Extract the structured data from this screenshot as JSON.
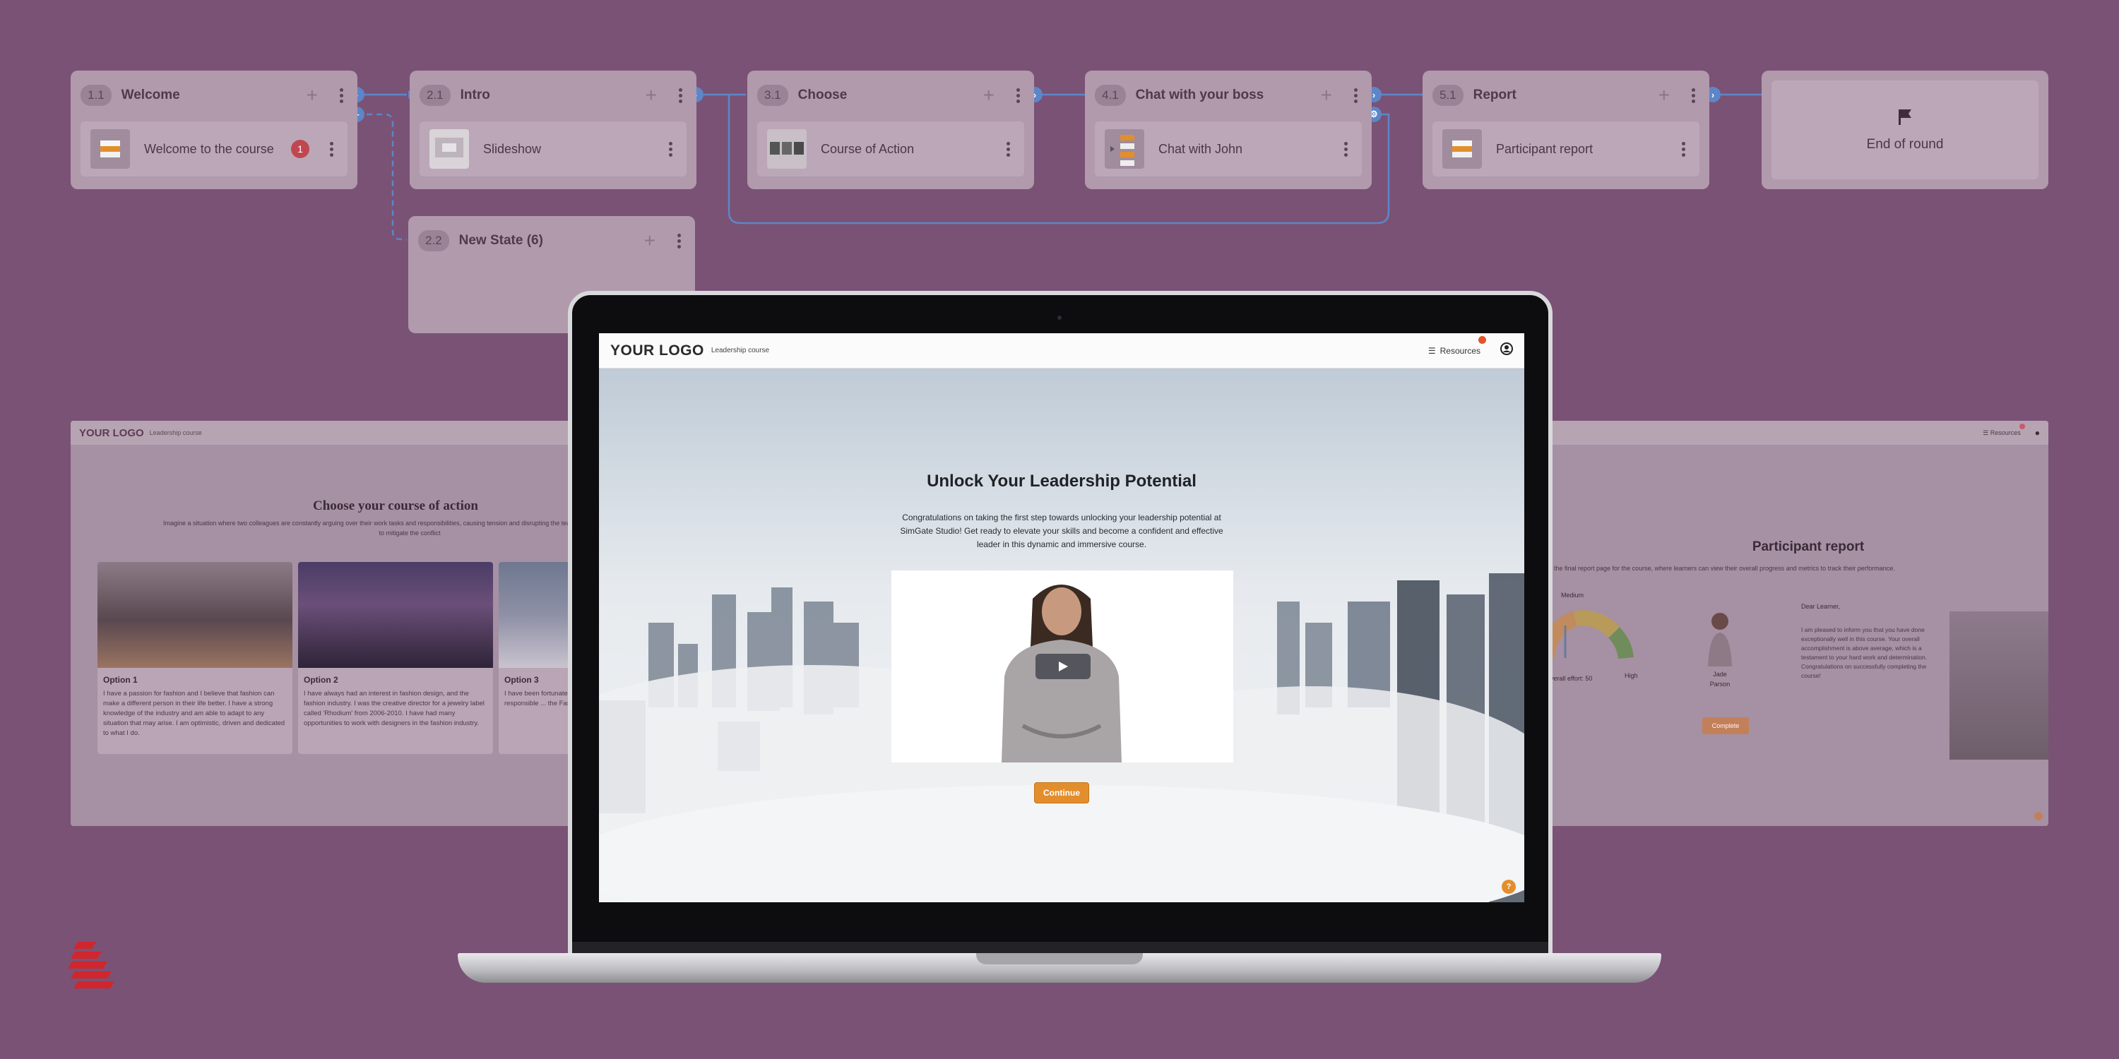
{
  "flow": {
    "states": [
      {
        "num": "1.1",
        "title": "Welcome",
        "item": "Welcome to the course",
        "badge": "1"
      },
      {
        "num": "2.1",
        "title": "Intro",
        "item": "Slideshow"
      },
      {
        "num": "3.1",
        "title": "Choose",
        "item": "Course of Action"
      },
      {
        "num": "4.1",
        "title": "Chat with your boss",
        "item": "Chat with John"
      },
      {
        "num": "5.1",
        "title": "Report",
        "item": "Participant report"
      }
    ],
    "new_state": {
      "num": "2.2",
      "title": "New State (6)"
    },
    "end": {
      "label": "End of round",
      "icon": "flag-icon"
    }
  },
  "left_screen": {
    "logo": "YOUR LOGO",
    "course": "Leadership course",
    "title": "Choose your course of action",
    "intro": "Imagine a situation where two colleagues are constantly arguing over their work tasks and responsibilities, causing tension and disrupting the team's productivity",
    "intro2": "to mitigate the conflict",
    "options": [
      {
        "title": "Option 1",
        "text": "I have a passion for fashion and I believe that fashion can make a different person in their life better. I have a strong knowledge of the industry and am able to adapt to any situation that may arise. I am optimistic, driven and dedicated to what I do."
      },
      {
        "title": "Option 2",
        "text": "I have always had an interest in fashion design, and the fashion industry. I was the creative director for a jewelry label called 'Rhodium' from 2006-2010. I have had many opportunities to work with designers in the fashion industry."
      },
      {
        "title": "Option 3",
        "text": "I have been fortunate... Fashion, Design and f... role I am responsible ... the Fashion Industry ..."
      }
    ]
  },
  "right_screen": {
    "resources": "Resources",
    "title": "Participant report",
    "subtitle": "the final report page for the course, where learners can view their overall progress and metrics to track their performance.",
    "gauge_label_top": "Medium",
    "gauge_label_high": "High",
    "gauge_caption": "overall effort: 50",
    "gauge_value": 50,
    "person_first": "Jade",
    "person_last": "Parson",
    "letter_greeting": "Dear Learner,",
    "letter_body": "I am pleased to inform you that you have done exceptionally well in this course. Your overall accomplishment is above average, which is a testament to your hard work and determination. Congratulations on successfully completing the course!",
    "complete_button": "Complete"
  },
  "main_screen": {
    "logo": "YOUR LOGO",
    "course": "Leadership course",
    "resources": "Resources",
    "title": "Unlock Your Leadership Potential",
    "text": "Congratulations on taking the first step towards unlocking your leadership potential at SimGate Studio! Get ready to elevate your skills and become a confident and effective leader in this dynamic and immersive course.",
    "continue": "Continue",
    "help": "?",
    "accent": "#e38e2d"
  },
  "colors": {
    "background": "#7a5275",
    "connector": "#5d86c8",
    "badge": "#c0474f",
    "brand": "#d0262e"
  }
}
